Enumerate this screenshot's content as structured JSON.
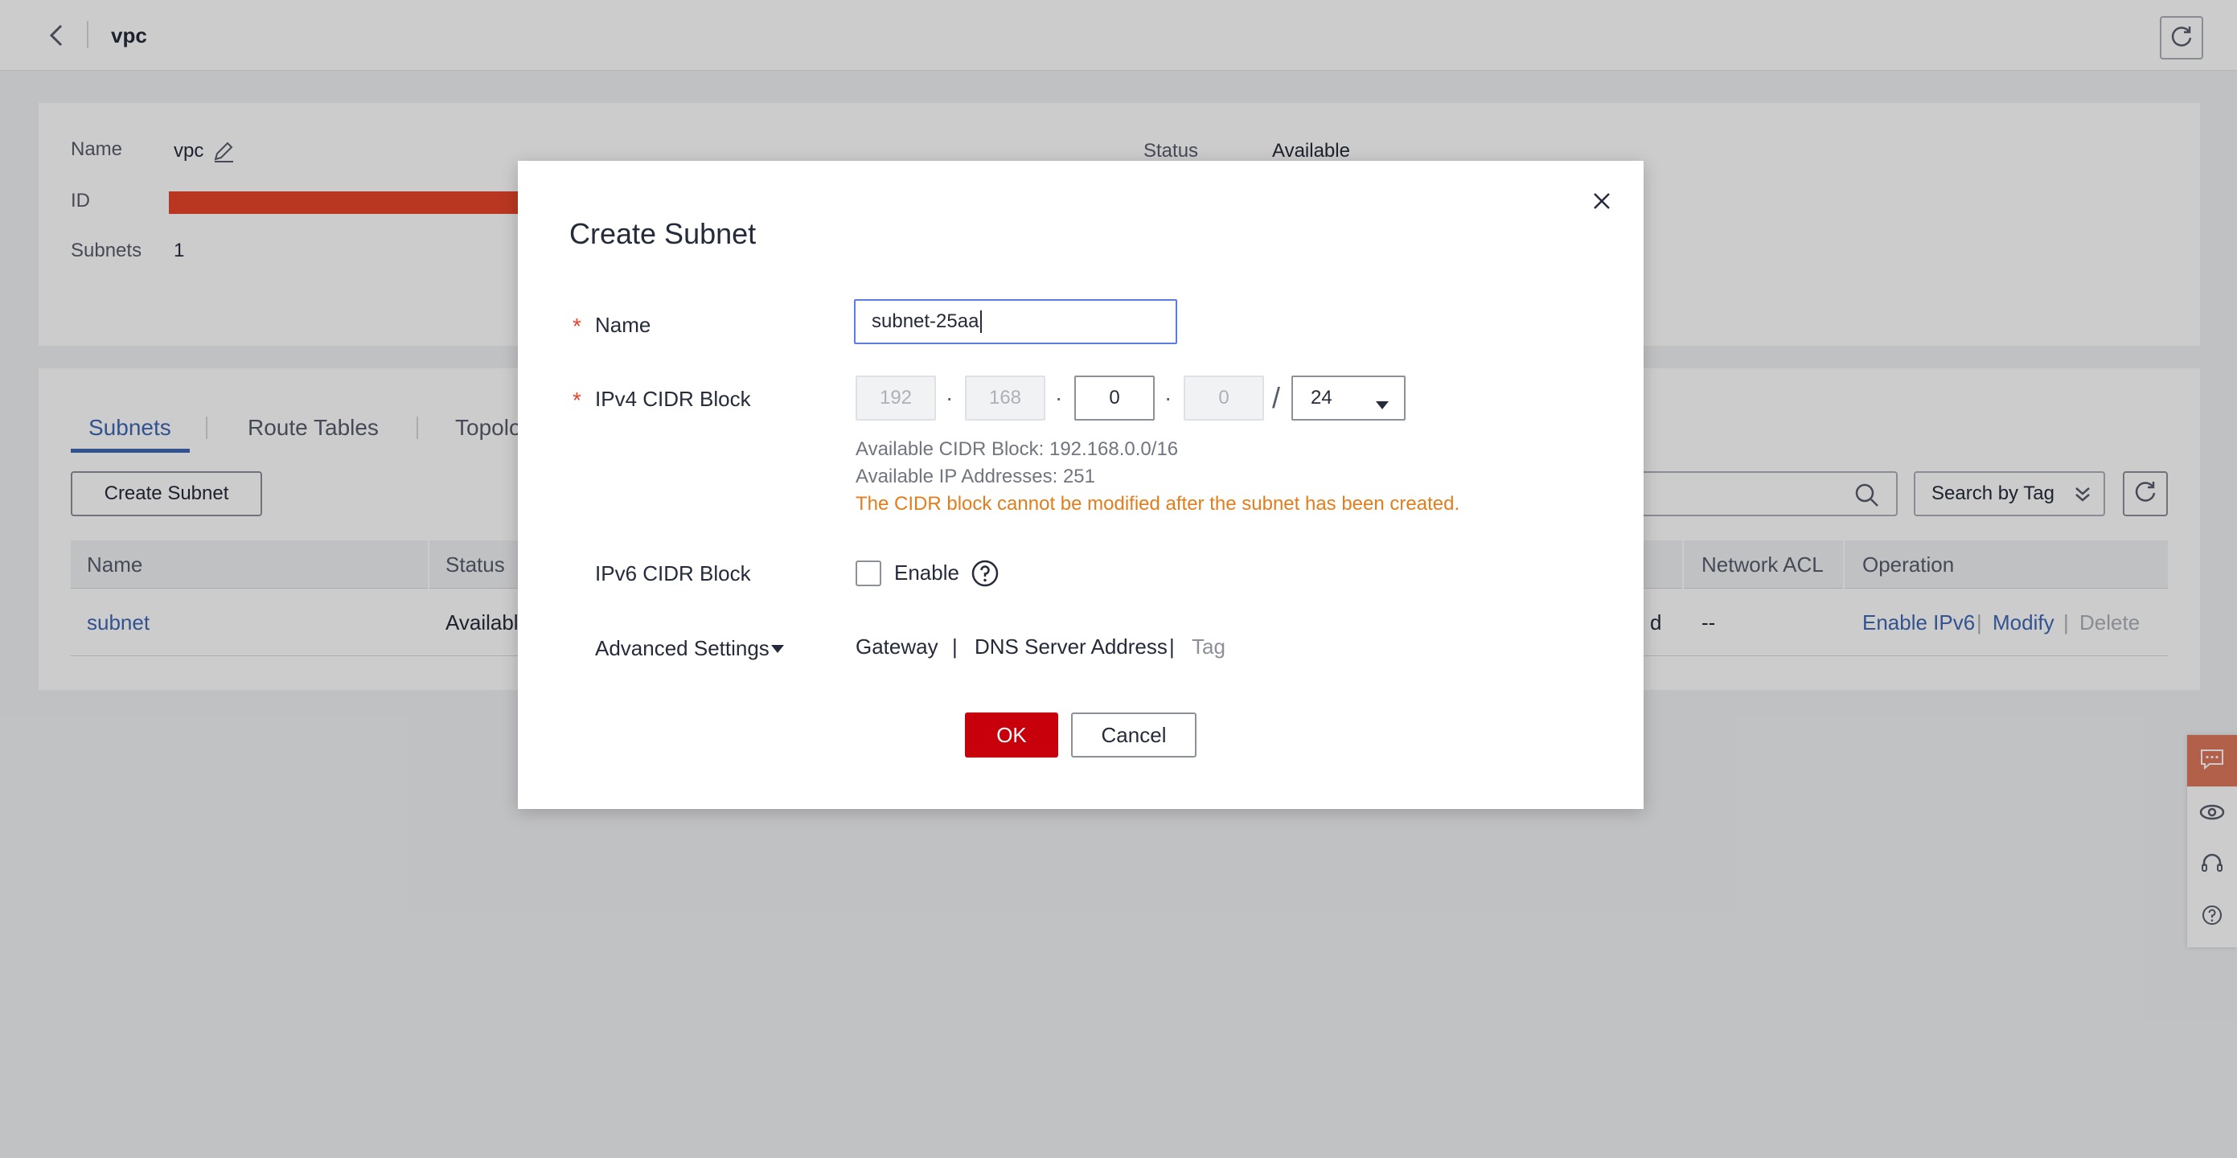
{
  "topbar": {
    "title": "vpc"
  },
  "info": {
    "name_label": "Name",
    "name_value": "vpc",
    "id_label": "ID",
    "subnets_label": "Subnets",
    "subnets_value": "1",
    "status_label": "Status",
    "status_value": "Available"
  },
  "tabs": [
    {
      "label": "Subnets"
    },
    {
      "label": "Route Tables"
    },
    {
      "label": "Topolo"
    }
  ],
  "toolbar": {
    "create_subnet_label": "Create Subnet",
    "search_by_tag_label": "Search by Tag"
  },
  "table": {
    "headers": {
      "name": "Name",
      "status": "Status",
      "network_acl": "Network ACL",
      "operation": "Operation"
    },
    "row": {
      "name": "subnet",
      "status": "Availabl",
      "partial": "d",
      "network_acl": "--",
      "op_enable_ipv6": "Enable IPv6",
      "op_modify": "Modify",
      "op_delete": "Delete"
    }
  },
  "dialog": {
    "title": "Create Subnet",
    "required_mark": "*",
    "name_label": "Name",
    "name_value": "subnet-25aa",
    "ipv4_label": "IPv4 CIDR Block",
    "octets": [
      "192",
      "168",
      "0",
      "0"
    ],
    "dot": "·",
    "slash": "/",
    "mask": "24",
    "available_cidr": "Available CIDR Block: 192.168.0.0/16",
    "available_ips": "Available IP Addresses: 251",
    "cidr_warning": "The CIDR block cannot be modified after the subnet has been created.",
    "ipv6_label": "IPv6 CIDR Block",
    "enable_label": "Enable",
    "advanced_label": "Advanced Settings",
    "adv_gateway": "Gateway",
    "adv_sep": "|",
    "adv_dns": "DNS Server Address",
    "adv_tag": "Tag",
    "ok_label": "OK",
    "cancel_label": "Cancel"
  },
  "colors": {
    "accent": "#3f67b4",
    "primary_button": "#c7000b",
    "warning": "#e37d1c",
    "required": "#e8452a"
  }
}
